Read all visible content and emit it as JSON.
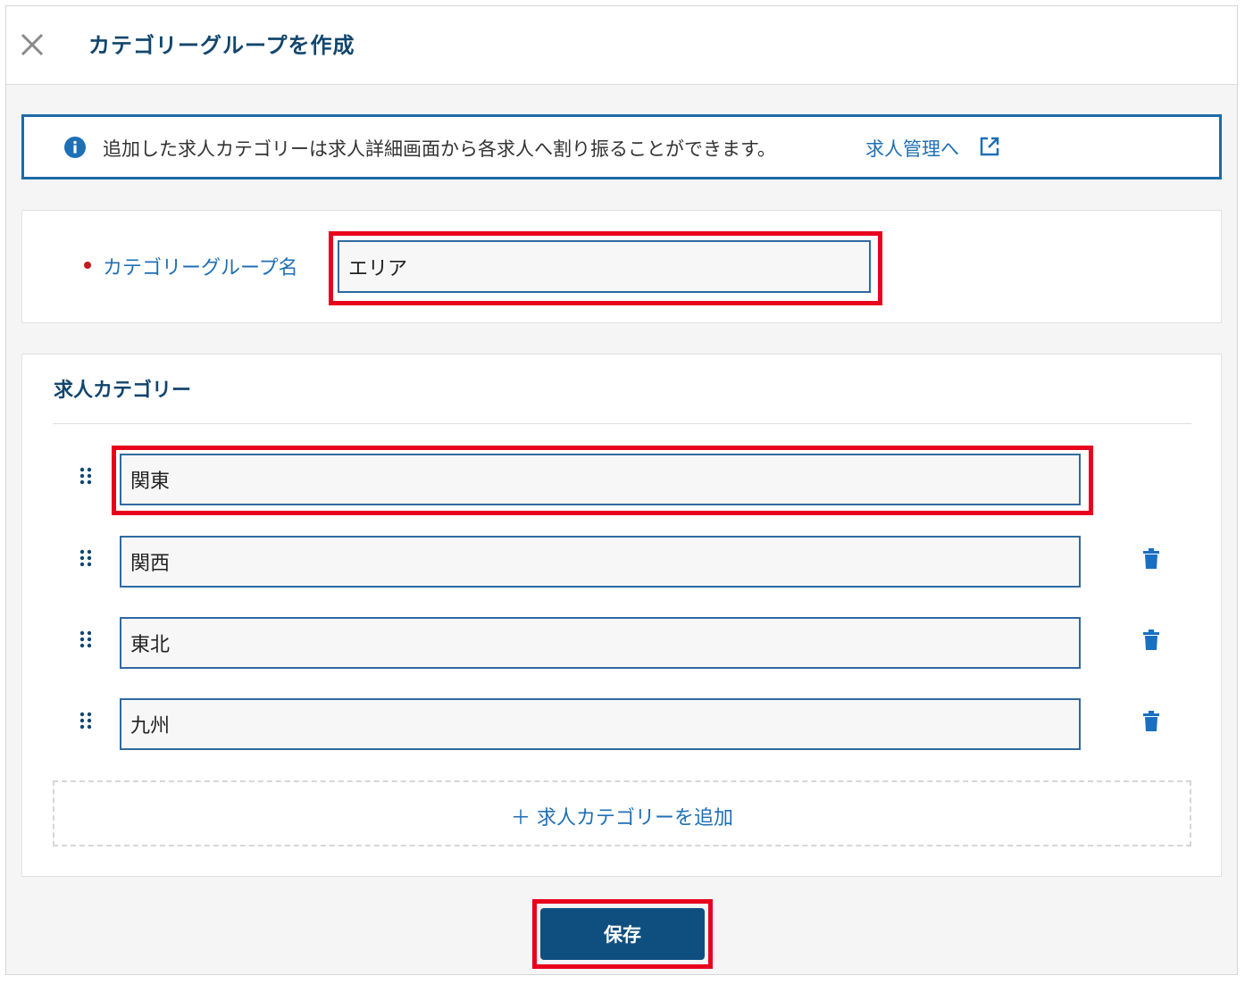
{
  "dialog": {
    "title": "カテゴリーグループを作成",
    "close_icon": "close-icon"
  },
  "info": {
    "icon": "info-icon",
    "text": "追加した求人カテゴリーは求人詳細画面から各求人へ割り振ることができます。",
    "link_label": "求人管理へ",
    "link_icon": "external-link-icon"
  },
  "group": {
    "label": "カテゴリーグループ名",
    "required": true,
    "value": "エリア"
  },
  "categories": {
    "title": "求人カテゴリー",
    "items": [
      {
        "value": "関東"
      },
      {
        "value": "関西"
      },
      {
        "value": "東北"
      },
      {
        "value": "九州"
      }
    ],
    "add_label": "＋ 求人カテゴリーを追加"
  },
  "actions": {
    "save_label": "保存"
  },
  "colors": {
    "accent": "#1f6fb5",
    "title": "#12466e",
    "primary_button": "#0f4f80",
    "highlight": "#e8001c",
    "required_dot": "#c81a1a"
  }
}
